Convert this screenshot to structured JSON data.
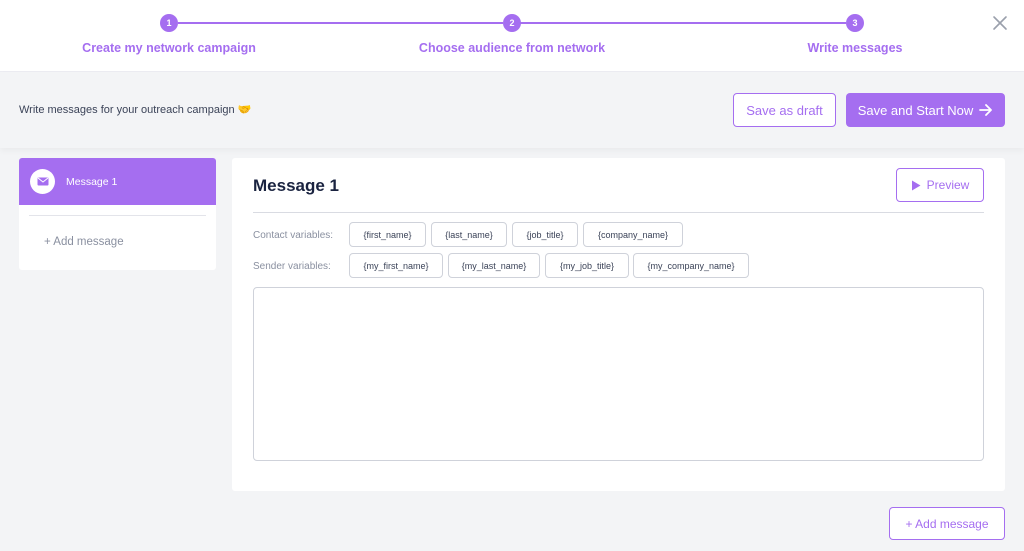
{
  "steps": [
    {
      "number": "1",
      "label": "Create my network campaign"
    },
    {
      "number": "2",
      "label": "Choose audience from network"
    },
    {
      "number": "3",
      "label": "Write messages"
    }
  ],
  "header": {
    "subtitle": "Write messages for your outreach campaign 🤝",
    "save_draft_label": "Save as draft",
    "save_start_label": "Save and Start Now"
  },
  "sidebar": {
    "items": [
      {
        "label": "Message 1",
        "active": true
      }
    ],
    "add_label": "+ Add message"
  },
  "editor": {
    "title": "Message 1",
    "preview_label": "Preview",
    "contact_label": "Contact variables:",
    "contact_vars": [
      "{first_name}",
      "{last_name}",
      "{job_title}",
      "{company_name}"
    ],
    "sender_label": "Sender variables:",
    "sender_vars": [
      "{my_first_name}",
      "{my_last_name}",
      "{my_job_title}",
      "{my_company_name}"
    ],
    "message_value": ""
  },
  "footer": {
    "add_label": "+ Add message"
  },
  "colors": {
    "accent": "#a56ef0",
    "background": "#f3f4f6",
    "text": "#1a2340"
  },
  "icons": [
    "close-icon",
    "envelope-icon",
    "play-icon",
    "arrow-right-icon"
  ]
}
